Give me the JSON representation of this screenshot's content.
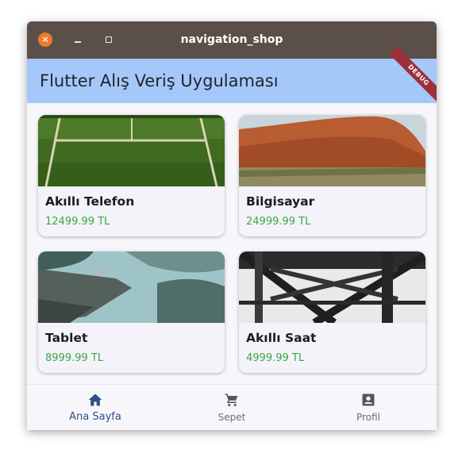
{
  "window": {
    "title": "navigation_shop",
    "close_glyph": "×"
  },
  "appbar": {
    "title": "Flutter Alış Veriş Uygulaması",
    "debug_banner": "DEBUG"
  },
  "products": [
    {
      "name": "Akıllı Telefon",
      "price": "12499.99 TL",
      "image_icon": "tennis-court-photo"
    },
    {
      "name": "Bilgisayar",
      "price": "24999.99 TL",
      "image_icon": "desert-rock-photo"
    },
    {
      "name": "Tablet",
      "price": "8999.99 TL",
      "image_icon": "cliff-lake-photo"
    },
    {
      "name": "Akıllı Saat",
      "price": "4999.99 TL",
      "image_icon": "steel-bridge-photo"
    }
  ],
  "bottom_nav": {
    "active_index": 0,
    "items": [
      {
        "label": "Ana Sayfa",
        "icon": "home-icon"
      },
      {
        "label": "Sepet",
        "icon": "cart-icon"
      },
      {
        "label": "Profil",
        "icon": "profile-icon"
      }
    ]
  },
  "colors": {
    "titlebar": "#5b5049",
    "appbar": "#a5c8fb",
    "price": "#3aa843",
    "active_nav": "#2f4f87",
    "close_button": "#f07b2c"
  }
}
